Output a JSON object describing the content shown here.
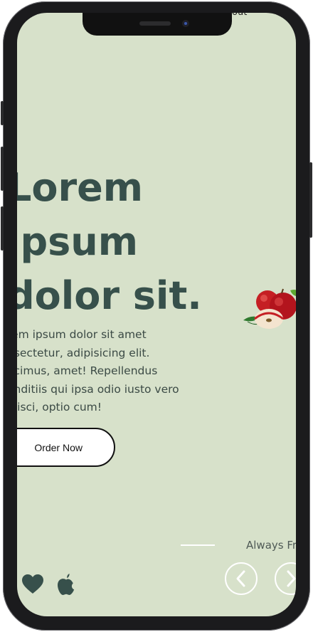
{
  "status_bar": {
    "corner_text": "out"
  },
  "hero": {
    "headline_lines": [
      "Lorem",
      "ipsum",
      "dolor sit."
    ],
    "body_lines": [
      "rem ipsum dolor sit amet",
      "nsectetur, adipisicing elit.",
      "ecimus, amet! Repellendus",
      "anditiis qui ipsa odio iusto vero",
      "ipisci, optio cum!"
    ],
    "order_button_label": "Order Now"
  },
  "slider": {
    "tagline": "Always Fre"
  },
  "colors": {
    "screen_bg": "#d7e1ca",
    "headline": "#37504b",
    "icon": "#37504b",
    "nav_button_outline": "#ffffff"
  },
  "icons": [
    "heart-icon",
    "apple-logo-icon",
    "chevron-left-icon",
    "chevron-right-icon",
    "apples-image"
  ]
}
